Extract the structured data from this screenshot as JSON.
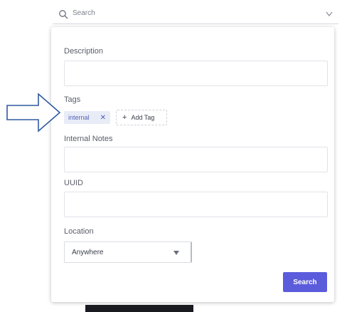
{
  "search": {
    "label": "Search"
  },
  "form": {
    "description_label": "Description",
    "tags_label": "Tags",
    "tags": [
      {
        "label": "internal"
      }
    ],
    "add_tag_label": "Add Tag",
    "internal_notes_label": "Internal Notes",
    "uuid_label": "UUID",
    "location_label": "Location",
    "location_value": "Anywhere",
    "search_button": "Search"
  },
  "colors": {
    "accent": "#5b5cdc",
    "tag_bg": "#e8ecf7",
    "arrow": "#2f5aa0"
  },
  "icons": [
    "search-icon",
    "chevron-down-icon",
    "close-icon",
    "plus-icon",
    "arrow-right-icon"
  ]
}
